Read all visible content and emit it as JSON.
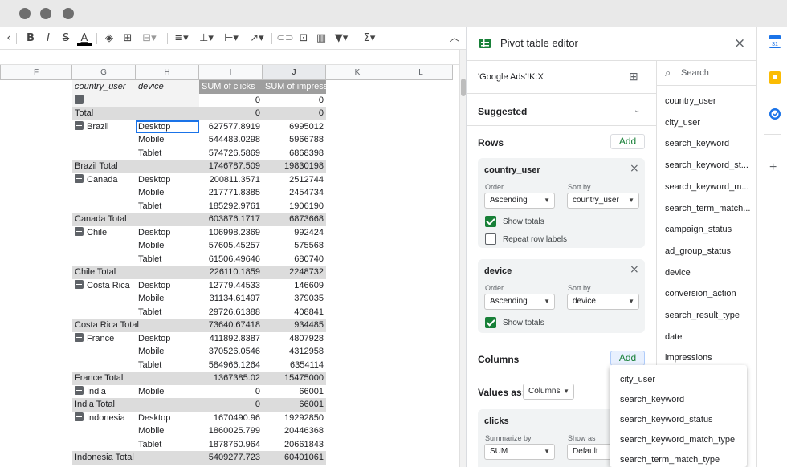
{
  "sheet": {
    "columns": [
      "F",
      "G",
      "H",
      "I",
      "J",
      "K",
      "L"
    ],
    "header": {
      "country_user": "country_user",
      "device": "device",
      "clicks": "SUM of clicks",
      "impressions": "SUM of impress"
    },
    "rows": [
      {
        "type": "blank",
        "country": "",
        "device": "",
        "clicks": "0",
        "impressions": "0"
      },
      {
        "type": "total",
        "country": "Total",
        "device": "",
        "clicks": "0",
        "impressions": "0"
      },
      {
        "type": "group",
        "country": "Brazil",
        "device": "Desktop",
        "clicks": "627577.8919",
        "impressions": "6995012"
      },
      {
        "type": "row",
        "country": "",
        "device": "Mobile",
        "clicks": "544483.0298",
        "impressions": "5966788"
      },
      {
        "type": "row",
        "country": "",
        "device": "Tablet",
        "clicks": "574726.5869",
        "impressions": "6868398"
      },
      {
        "type": "total",
        "country": "Brazil Total",
        "device": "",
        "clicks": "1746787.509",
        "impressions": "19830198"
      },
      {
        "type": "group",
        "country": "Canada",
        "device": "Desktop",
        "clicks": "200811.3571",
        "impressions": "2512744"
      },
      {
        "type": "row",
        "country": "",
        "device": "Mobile",
        "clicks": "217771.8385",
        "impressions": "2454734"
      },
      {
        "type": "row",
        "country": "",
        "device": "Tablet",
        "clicks": "185292.9761",
        "impressions": "1906190"
      },
      {
        "type": "total",
        "country": "Canada Total",
        "device": "",
        "clicks": "603876.1717",
        "impressions": "6873668"
      },
      {
        "type": "group",
        "country": "Chile",
        "device": "Desktop",
        "clicks": "106998.2369",
        "impressions": "992424"
      },
      {
        "type": "row",
        "country": "",
        "device": "Mobile",
        "clicks": "57605.45257",
        "impressions": "575568"
      },
      {
        "type": "row",
        "country": "",
        "device": "Tablet",
        "clicks": "61506.49646",
        "impressions": "680740"
      },
      {
        "type": "total",
        "country": "Chile Total",
        "device": "",
        "clicks": "226110.1859",
        "impressions": "2248732"
      },
      {
        "type": "group",
        "country": "Costa Rica",
        "device": "Desktop",
        "clicks": "12779.44533",
        "impressions": "146609"
      },
      {
        "type": "row",
        "country": "",
        "device": "Mobile",
        "clicks": "31134.61497",
        "impressions": "379035"
      },
      {
        "type": "row",
        "country": "",
        "device": "Tablet",
        "clicks": "29726.61388",
        "impressions": "408841"
      },
      {
        "type": "total",
        "country": "Costa Rica Total",
        "device": "",
        "clicks": "73640.67418",
        "impressions": "934485"
      },
      {
        "type": "group",
        "country": "France",
        "device": "Desktop",
        "clicks": "411892.8387",
        "impressions": "4807928"
      },
      {
        "type": "row",
        "country": "",
        "device": "Mobile",
        "clicks": "370526.0546",
        "impressions": "4312958"
      },
      {
        "type": "row",
        "country": "",
        "device": "Tablet",
        "clicks": "584966.1264",
        "impressions": "6354114"
      },
      {
        "type": "total",
        "country": "France Total",
        "device": "",
        "clicks": "1367385.02",
        "impressions": "15475000"
      },
      {
        "type": "group",
        "country": "India",
        "device": "Mobile",
        "clicks": "0",
        "impressions": "66001"
      },
      {
        "type": "total",
        "country": "India Total",
        "device": "",
        "clicks": "0",
        "impressions": "66001"
      },
      {
        "type": "group",
        "country": "Indonesia",
        "device": "Desktop",
        "clicks": "1670490.96",
        "impressions": "19292850"
      },
      {
        "type": "row",
        "country": "",
        "device": "Mobile",
        "clicks": "1860025.799",
        "impressions": "20446368"
      },
      {
        "type": "row",
        "country": "",
        "device": "Tablet",
        "clicks": "1878760.964",
        "impressions": "20661843"
      },
      {
        "type": "total",
        "country": "Indonesia Total",
        "device": "",
        "clicks": "5409277.723",
        "impressions": "60401061"
      }
    ]
  },
  "editor": {
    "title": "Pivot table editor",
    "range": "'Google Ads'!K:X",
    "suggested": "Suggested",
    "rows_label": "Rows",
    "add": "Add",
    "columns_label": "Columns",
    "values_as": "Values as:",
    "values_as_value": "Columns",
    "order": "Order",
    "sort_by": "Sort by",
    "ascending": "Ascending",
    "show_totals": "Show totals",
    "repeat_row_labels": "Repeat row labels",
    "card1": {
      "name": "country_user",
      "sort_value": "country_user"
    },
    "card2": {
      "name": "device",
      "sort_value": "device"
    },
    "card3": {
      "name": "clicks",
      "summarize_by": "Summarize by",
      "summarize_value": "SUM",
      "show_as": "Show as",
      "show_as_value": "Default"
    }
  },
  "fields": {
    "search_placeholder": "Search",
    "items": [
      "country_user",
      "city_user",
      "search_keyword",
      "search_keyword_st...",
      "search_keyword_m...",
      "search_term_match...",
      "campaign_status",
      "ad_group_status",
      "device",
      "conversion_action",
      "search_result_type",
      "date",
      "impressions"
    ]
  },
  "dropdown": {
    "items": [
      "city_user",
      "search_keyword",
      "search_keyword_status",
      "search_keyword_match_type",
      "search_term_match_type"
    ]
  },
  "colors": {
    "accent_green": "#188038",
    "header_gray": "#9e9e9e",
    "total_gray": "#dcdcdc"
  }
}
